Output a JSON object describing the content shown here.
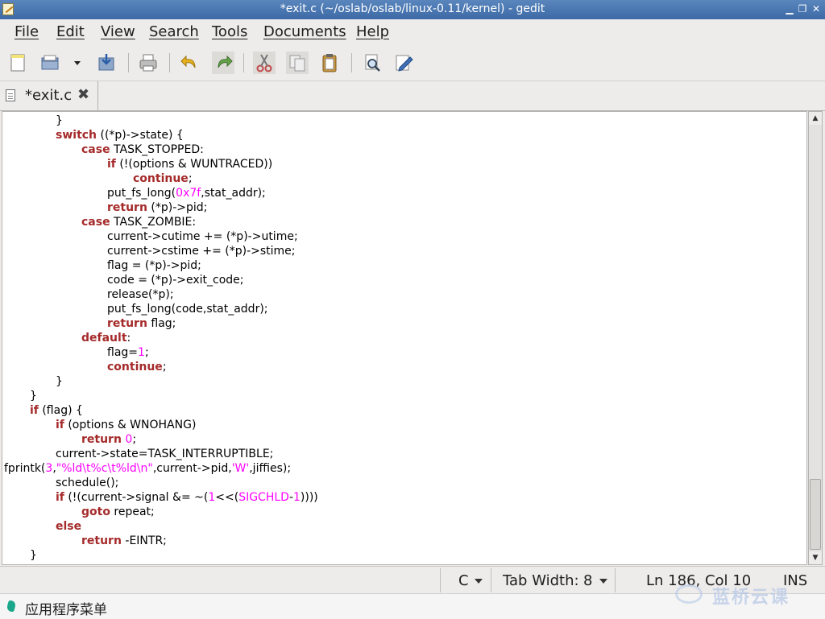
{
  "window": {
    "title": "*exit.c (~/oslab/oslab/linux-0.11/kernel) - gedit",
    "controls": [
      "minimize",
      "maximize",
      "close"
    ]
  },
  "menu": [
    {
      "label": "File",
      "key": "F",
      "rest": "ile"
    },
    {
      "label": "Edit",
      "key": "E",
      "rest": "dit"
    },
    {
      "label": "View",
      "key": "V",
      "rest": "iew"
    },
    {
      "label": "Search",
      "key": "S",
      "rest": "earch"
    },
    {
      "label": "Tools",
      "key": "T",
      "rest": "ools"
    },
    {
      "label": "Documents",
      "key": "D",
      "rest": "ocuments"
    },
    {
      "label": "Help",
      "key": "H",
      "rest": "elp"
    }
  ],
  "toolbar": {
    "buttons": [
      "new-document-icon",
      "open-icon",
      "open-dropdown-icon",
      "save-icon",
      "print-icon",
      "undo-icon",
      "redo-icon",
      "cut-icon",
      "copy-icon",
      "paste-icon",
      "find-icon",
      "replace-icon"
    ]
  },
  "tab": {
    "label": "*exit.c",
    "close_glyph": "✖"
  },
  "code": [
    [
      [
        "t",
        "        }"
      ]
    ],
    [
      [
        "t",
        "        "
      ],
      [
        "k",
        "switch"
      ],
      [
        "t",
        " ((*p)->state) {"
      ]
    ],
    [
      [
        "t",
        "            "
      ],
      [
        "k",
        "case"
      ],
      [
        "t",
        " TASK_STOPPED:"
      ]
    ],
    [
      [
        "t",
        "                "
      ],
      [
        "k",
        "if"
      ],
      [
        "t",
        " (!(options & WUNTRACED))"
      ]
    ],
    [
      [
        "t",
        "                    "
      ],
      [
        "k",
        "continue"
      ],
      [
        "t",
        ";"
      ]
    ],
    [
      [
        "t",
        "                put_fs_long("
      ],
      [
        "n",
        "0x7f"
      ],
      [
        "t",
        ",stat_addr);"
      ]
    ],
    [
      [
        "t",
        "                "
      ],
      [
        "k",
        "return"
      ],
      [
        "t",
        " (*p)->pid;"
      ]
    ],
    [
      [
        "t",
        "            "
      ],
      [
        "k",
        "case"
      ],
      [
        "t",
        " TASK_ZOMBIE:"
      ]
    ],
    [
      [
        "t",
        "                current->cutime += (*p)->utime;"
      ]
    ],
    [
      [
        "t",
        "                current->cstime += (*p)->stime;"
      ]
    ],
    [
      [
        "t",
        "                flag = (*p)->pid;"
      ]
    ],
    [
      [
        "t",
        "                code = (*p)->exit_code;"
      ]
    ],
    [
      [
        "t",
        "                release(*p);"
      ]
    ],
    [
      [
        "t",
        "                put_fs_long(code,stat_addr);"
      ]
    ],
    [
      [
        "t",
        "                "
      ],
      [
        "k",
        "return"
      ],
      [
        "t",
        " flag;"
      ]
    ],
    [
      [
        "t",
        "            "
      ],
      [
        "k",
        "default"
      ],
      [
        "t",
        ":"
      ]
    ],
    [
      [
        "t",
        "                flag="
      ],
      [
        "n",
        "1"
      ],
      [
        "t",
        ";"
      ]
    ],
    [
      [
        "t",
        "                "
      ],
      [
        "k",
        "continue"
      ],
      [
        "t",
        ";"
      ]
    ],
    [
      [
        "t",
        "        }"
      ]
    ],
    [
      [
        "t",
        "    }"
      ]
    ],
    [
      [
        "t",
        "    "
      ],
      [
        "k",
        "if"
      ],
      [
        "t",
        " (flag) {"
      ]
    ],
    [
      [
        "t",
        "        "
      ],
      [
        "k",
        "if"
      ],
      [
        "t",
        " (options & WNOHANG)"
      ]
    ],
    [
      [
        "t",
        "            "
      ],
      [
        "k",
        "return"
      ],
      [
        "t",
        " "
      ],
      [
        "n",
        "0"
      ],
      [
        "t",
        ";"
      ]
    ],
    [
      [
        "t",
        "        current->state=TASK_INTERRUPTIBLE;"
      ]
    ],
    [
      [
        "t",
        "fprintk("
      ],
      [
        "n",
        "3"
      ],
      [
        "t",
        ","
      ],
      [
        "s",
        "\"%ld\\t%c\\t%ld\\n\""
      ],
      [
        "t",
        ",current->pid,"
      ],
      [
        "s",
        "'W'"
      ],
      [
        "t",
        ",jiffies);"
      ]
    ],
    [
      [
        "t",
        "        schedule();"
      ]
    ],
    [
      [
        "t",
        "        "
      ],
      [
        "k",
        "if"
      ],
      [
        "t",
        " (!(current->signal &= ~("
      ],
      [
        "n",
        "1"
      ],
      [
        "t",
        "<<("
      ],
      [
        "n",
        "SIGCHLD"
      ],
      [
        "t",
        "-"
      ],
      [
        "n",
        "1"
      ],
      [
        "t",
        "))))"
      ]
    ],
    [
      [
        "t",
        "            "
      ],
      [
        "k",
        "goto"
      ],
      [
        "t",
        " repeat;"
      ]
    ],
    [
      [
        "t",
        "        "
      ],
      [
        "k",
        "else"
      ]
    ],
    [
      [
        "t",
        "            "
      ],
      [
        "k",
        "return"
      ],
      [
        "t",
        " -EINTR;"
      ]
    ],
    [
      [
        "t",
        "    }"
      ]
    ]
  ],
  "code_indent": [
    8,
    8,
    12,
    16,
    20,
    16,
    16,
    12,
    16,
    16,
    16,
    16,
    16,
    16,
    16,
    12,
    16,
    16,
    8,
    4,
    4,
    8,
    12,
    8,
    0,
    8,
    8,
    12,
    8,
    12,
    4
  ],
  "status": {
    "language": "C",
    "tab_width_label": "Tab Width:",
    "tab_width_value": "8",
    "position": "Ln 186, Col 10",
    "mode": "INS"
  },
  "taskbar": {
    "start_label": "应用程序菜单",
    "watermark": "蓝桥云课"
  }
}
